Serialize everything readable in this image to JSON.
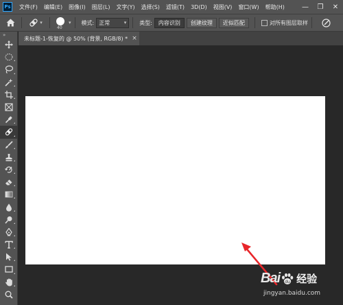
{
  "app": {
    "logo_text": "Ps"
  },
  "menu": [
    "文件(F)",
    "编辑(E)",
    "图像(I)",
    "图层(L)",
    "文字(Y)",
    "选择(S)",
    "滤镜(T)",
    "3D(D)",
    "视图(V)",
    "窗口(W)",
    "帮助(H)"
  ],
  "window_controls": {
    "minimize": "—",
    "restore": "❐",
    "close": "✕"
  },
  "options": {
    "brush_size": "40",
    "mode_label": "模式:",
    "mode_value": "正常",
    "type_label": "类型:",
    "type_buttons": [
      "内容识别",
      "创建纹理",
      "近似匹配"
    ],
    "active_type": "内容识别",
    "sample_all_layers_label": "对所有图层取样",
    "sample_all_layers_checked": false
  },
  "tools": [
    {
      "name": "move-tool",
      "icon": "move-icon"
    },
    {
      "name": "marquee-tool",
      "icon": "marquee-icon"
    },
    {
      "name": "lasso-tool",
      "icon": "lasso-icon"
    },
    {
      "name": "magic-wand-tool",
      "icon": "magic-wand-icon"
    },
    {
      "name": "crop-tool",
      "icon": "crop-icon"
    },
    {
      "name": "frame-tool",
      "icon": "frame-icon"
    },
    {
      "name": "eyedropper-tool",
      "icon": "eyedropper-icon"
    },
    {
      "name": "spot-healing-brush-tool",
      "icon": "bandage-icon",
      "active": true
    },
    {
      "name": "brush-tool",
      "icon": "brush-icon"
    },
    {
      "name": "clone-stamp-tool",
      "icon": "stamp-icon"
    },
    {
      "name": "history-brush-tool",
      "icon": "history-brush-icon"
    },
    {
      "name": "eraser-tool",
      "icon": "eraser-icon"
    },
    {
      "name": "gradient-tool",
      "icon": "gradient-icon"
    },
    {
      "name": "blur-tool",
      "icon": "drop-icon"
    },
    {
      "name": "dodge-tool",
      "icon": "dodge-icon"
    },
    {
      "name": "pen-tool",
      "icon": "pen-icon"
    },
    {
      "name": "type-tool",
      "icon": "type-icon"
    },
    {
      "name": "path-selection-tool",
      "icon": "arrow-icon"
    },
    {
      "name": "rectangle-tool",
      "icon": "rectangle-icon"
    },
    {
      "name": "hand-tool",
      "icon": "hand-icon"
    },
    {
      "name": "zoom-tool",
      "icon": "zoom-icon"
    }
  ],
  "document": {
    "tab_title": "未标题-1-恢复的 @ 50% (背景, RGB/8) *",
    "close_glyph": "×"
  },
  "colors": {
    "chrome": "#535353",
    "workspace": "#282828",
    "canvas": "#ffffff",
    "arrow": "#e8262a"
  },
  "watermark": {
    "brand_left": "Bai",
    "brand_right": "du",
    "brand_text": "经验",
    "url": "jingyan.baidu.com"
  }
}
